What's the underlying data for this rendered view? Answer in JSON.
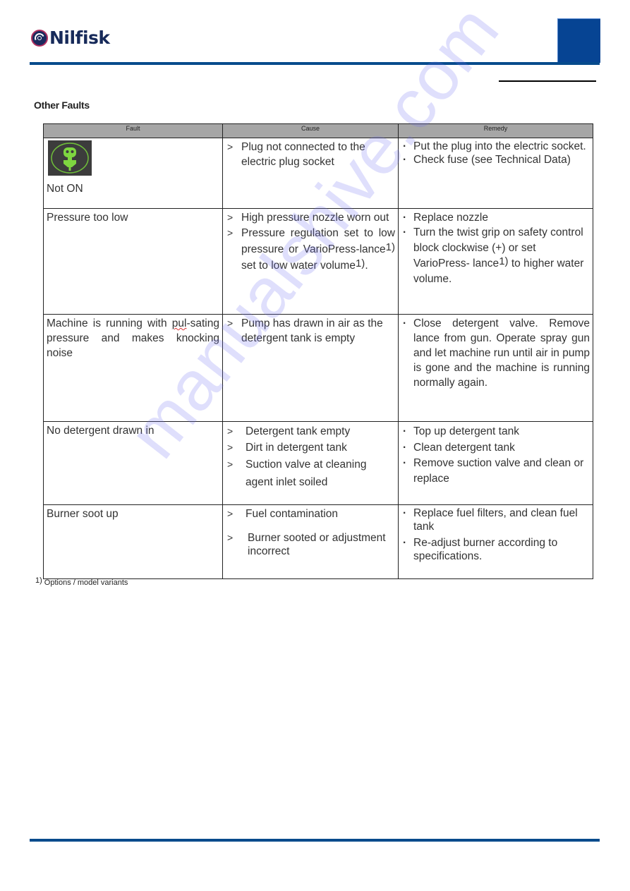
{
  "header": {
    "brand": "Nilfisk",
    "brand_color": "#172a5a",
    "rule_color": "#064b8c",
    "tab_color": "#064493"
  },
  "section": {
    "title": "Other Faults"
  },
  "table": {
    "columns": [
      "Fault",
      "Cause",
      "Remedy"
    ],
    "rows": [
      {
        "fault": "Not ON",
        "fault_icon": "power-plug-icon",
        "causes": [
          "Plug not connected to the electric plug socket"
        ],
        "remedies": [
          "Put the plug into the electric socket.",
          "Check fuse (see Technical Data)"
        ]
      },
      {
        "fault": "Pressure too low",
        "causes": [
          "High pressure nozzle worn out",
          "Pressure regulation set to low pressure or VarioPress-lance1) set to low water volume1)."
        ],
        "causes_parts": {
          "c2_a": "Pressure regulation set to low pressure or VarioPress-lance",
          "c2_sup1": "1)",
          "c2_b": " set to low water volume",
          "c2_sup2": "1)",
          "c2_c": "."
        },
        "remedies": [
          "Replace nozzle",
          "Turn the twist grip on safety control block clockwise (+) or set VarioPress- lance1) to higher water volume."
        ],
        "remedies_parts": {
          "r2_a": "Turn the twist grip on safety control block clockwise (+) or set VarioPress- lance",
          "r2_sup": "1)",
          "r2_b": " to higher water volume."
        }
      },
      {
        "fault": "Machine is running with pulsating pressure and makes knocking noise",
        "fault_parts": {
          "a": "Machine is running with ",
          "b": "pul",
          "c": "-sating pressure and makes knocking noise"
        },
        "causes": [
          "Pump has drawn in air as the detergent tank is empty"
        ],
        "remedies": [
          "Close detergent valve. Remove lance from gun. Operate spray gun and let machine run until air in pump is gone and the machine is running normally again."
        ]
      },
      {
        "fault": "No detergent drawn in",
        "causes": [
          "Detergent tank empty",
          "Dirt in detergent tank",
          "Suction valve at cleaning agent inlet soiled"
        ],
        "remedies": [
          "Top up detergent tank",
          "Clean detergent tank",
          "Remove suction valve and clean or replace"
        ]
      },
      {
        "fault": "Burner soot up",
        "causes": [
          "Fuel contamination",
          "Burner sooted or adjustment incorrect"
        ],
        "remedies": [
          "Replace fuel filters, and clean fuel tank",
          "Re-adjust burner according to specifications."
        ]
      }
    ]
  },
  "footnote": {
    "mark": "1)",
    "text": "Options / model variants"
  },
  "watermark": "manualshive.com"
}
